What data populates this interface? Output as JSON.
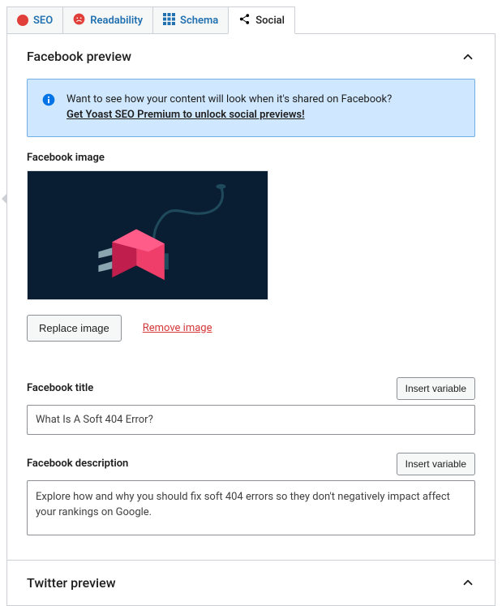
{
  "tabs": {
    "seo": "SEO",
    "readability": "Readability",
    "schema": "Schema",
    "social": "Social"
  },
  "facebook": {
    "section_title": "Facebook preview",
    "notice_text": "Want to see how your content will look when it's shared on Facebook?",
    "notice_link": "Get Yoast SEO Premium to unlock social previews!",
    "image_label": "Facebook image",
    "replace_button": "Replace image",
    "remove_link": "Remove image",
    "title_label": "Facebook title",
    "title_value": "What Is A Soft 404 Error?",
    "description_label": "Facebook description",
    "description_value": "Explore how and why you should fix soft 404 errors so they don't negatively impact affect your rankings on Google.",
    "insert_variable": "Insert variable"
  },
  "twitter": {
    "section_title": "Twitter preview"
  }
}
